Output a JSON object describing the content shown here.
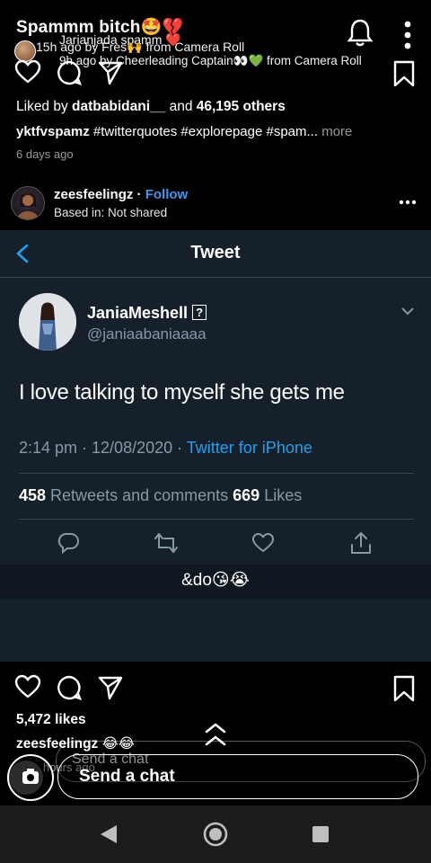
{
  "overlay": {
    "title": "Spammm bitch🤩💔",
    "line_a": "Jarianjada spamm ❤️",
    "line_b": "15h ago by Fres🙌 from Camera Roll",
    "line_c": "9h ago by Cheerleading Captain👀💚 from Camera Roll"
  },
  "post_top": {
    "liked_prefix": "Liked by ",
    "liked_user": "datbabidani__",
    "liked_and": " and ",
    "liked_count": "46,195 others",
    "caption_user": "yktfvspamz",
    "caption_text": " #twitterquotes #explorepage #spam...",
    "more": " more",
    "ago": "6 days ago"
  },
  "post": {
    "username": "zeesfeelingz",
    "dot": " · ",
    "follow": "Follow",
    "location": "Based in: Not shared"
  },
  "tweet": {
    "header_title": "Tweet",
    "name": "JaniaMeshell",
    "badge": "?",
    "handle": "@janiaabaniaaaa",
    "text": "I love talking to myself she gets me",
    "time": "2:14 pm · 12/08/2020 · ",
    "source": "Twitter for iPhone",
    "retweets": "458",
    "retweets_label": " Retweets and comments ",
    "likes": "669",
    "likes_label": " Likes"
  },
  "strip_text": "&do😘😭",
  "post_bottom": {
    "likes": "5,472 likes",
    "comment_user": "zeesfeelingz",
    "comment_text": " 😂😂",
    "hours": "hours ago"
  },
  "chat": {
    "ghost_placeholder": "Send a chat",
    "placeholder": "Send a chat"
  },
  "colors": {
    "tweet_bg": "#15202b",
    "twitter_blue": "#1da1f2",
    "instagram_blue": "#3897f0",
    "muted": "#8899a6"
  }
}
